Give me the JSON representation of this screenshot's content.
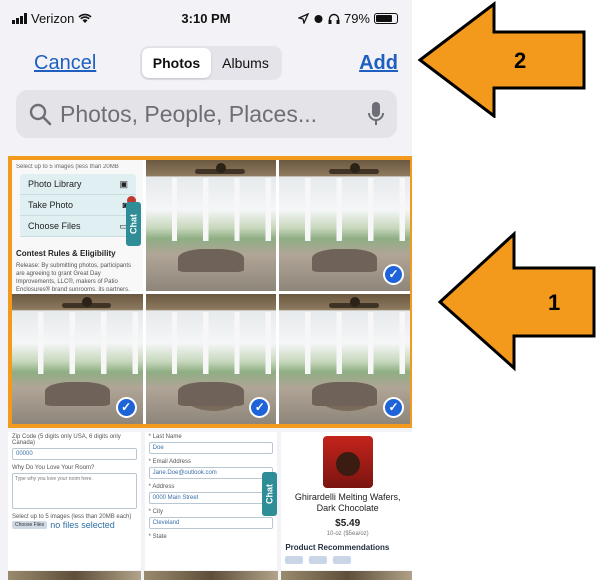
{
  "status_bar": {
    "carrier": "Verizon",
    "time": "3:10 PM",
    "battery": "79%"
  },
  "nav": {
    "cancel": "Cancel",
    "tabs": [
      "Photos",
      "Albums"
    ],
    "active_tab": "Photos",
    "add": "Add"
  },
  "search": {
    "placeholder": "Photos, People, Places..."
  },
  "grid": {
    "form_tile": {
      "hint": "Select up to 5 images (less than 20MB",
      "menu": [
        "Photo Library",
        "Take Photo",
        "Choose Files"
      ],
      "chat": "Chat",
      "rules_title": "Contest Rules & Eligibility",
      "rules_text": "Release: By submitting photos, participants are agreeing to grant Great Day Improvements, LLC®, makers of Patio Enclosures® brand sunrooms, its partners, affiliates, subsidiaries, agents and employees, the absolute and irrevocable right and"
    },
    "checkmark": "✓"
  },
  "webpage": {
    "col1": {
      "zip_label": "Zip Code (5 digits only USA, 6 digits only Canada)",
      "zip_value": "00000",
      "love_label": "Why Do You Love Your Room?",
      "love_placeholder": "Type why you love your room here.",
      "select_hint": "Select up to 5 images (less than 20MB each)",
      "choose_btn": "Choose Files",
      "no_files": "no files selected"
    },
    "col2": {
      "last_name_label": "* Last Name",
      "last_name_value": "Doe",
      "email_label": "* Email Address",
      "email_value": "Jane.Doe@outlook.com",
      "address_label": "* Address",
      "address_value": "0000 Main Street",
      "city_label": "* City",
      "city_value": "Cleveland",
      "state_label": "* State",
      "chat": "Chat"
    },
    "col3": {
      "product_name": "Ghirardelli Melting Wafers, Dark Chocolate",
      "price": "$5.49",
      "unit": "10-oz ($5ea/oz)",
      "recs_title": "Product Recommendations"
    }
  },
  "annotations": [
    {
      "label": "2",
      "color": "#f39a1d"
    },
    {
      "label": "1",
      "color": "#f39a1d"
    }
  ]
}
